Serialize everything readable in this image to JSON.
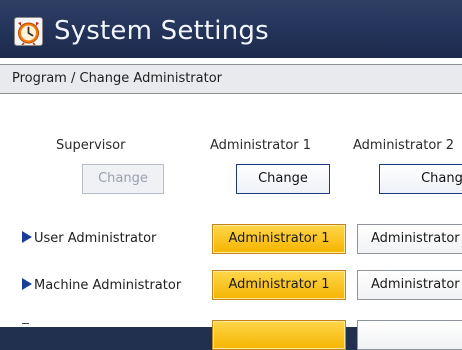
{
  "window": {
    "title": "System Settings",
    "icon": "clock-icon"
  },
  "header": {
    "breadcrumb": "Program / Change Administrator"
  },
  "columns": [
    {
      "label": "Supervisor",
      "button": "Change",
      "enabled": false
    },
    {
      "label": "Administrator 1",
      "button": "Change",
      "enabled": true
    },
    {
      "label": "Administrator 2",
      "button": "Change",
      "enabled": true
    }
  ],
  "rows": [
    {
      "label": "User Administrator",
      "selected": "Administrator 1",
      "next": "Administrator"
    },
    {
      "label": "Machine Administrator",
      "selected": "Administrator 1",
      "next": "Administrator"
    }
  ],
  "colors": {
    "title_bar": "#24345a",
    "selected_button": "#f5b400",
    "accent_blue": "#1b3f99"
  }
}
